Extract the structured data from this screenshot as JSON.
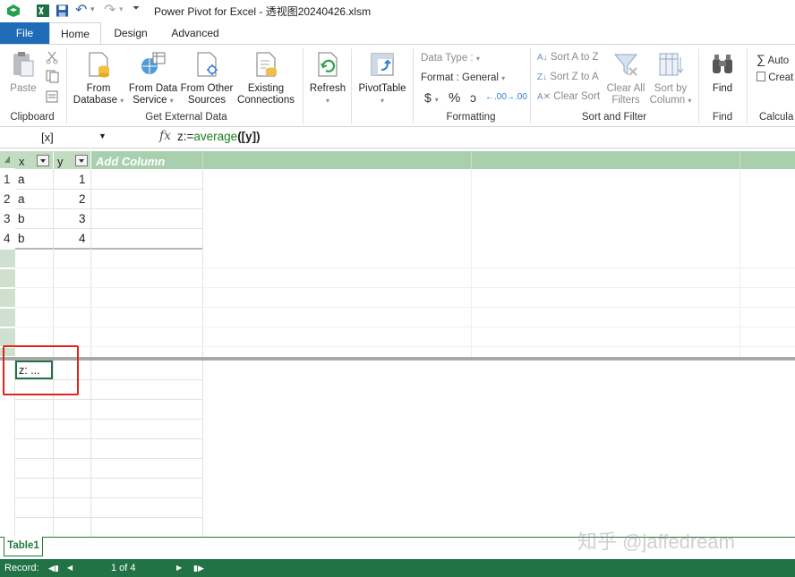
{
  "window": {
    "title": "Power Pivot for Excel - 透视图20240426.xlsm"
  },
  "tabs": [
    {
      "label": "File"
    },
    {
      "label": "Home"
    },
    {
      "label": "Design"
    },
    {
      "label": "Advanced"
    }
  ],
  "ribbon": {
    "clipboard": {
      "paste": "Paste",
      "group": "Clipboard"
    },
    "external": {
      "from_database": [
        "From",
        "Database"
      ],
      "from_data_service": [
        "From Data",
        "Service"
      ],
      "from_other_sources": [
        "From Other",
        "Sources"
      ],
      "existing_connections": [
        "Existing",
        "Connections"
      ],
      "group": "Get External Data"
    },
    "refresh": "Refresh",
    "pivottable": "PivotTable",
    "formatting": {
      "data_type": "Data Type :",
      "format": "Format : General",
      "currency": "$",
      "percent": "%",
      "comma": "ɒ",
      "inc_dec": "←.00",
      "dec_dec": "→.00",
      "group": "Formatting"
    },
    "sort": {
      "sort_az": "Sort A to Z",
      "sort_za": "Sort Z to A",
      "clear_sort": "Clear Sort",
      "clear_filters": [
        "Clear All",
        "Filters"
      ],
      "sort_by_column": [
        "Sort by",
        "Column"
      ],
      "group": "Sort and Filter"
    },
    "find": {
      "label": "Find",
      "group": "Find"
    },
    "calc": {
      "autosum": "Auto",
      "create": "Creat",
      "group": "Calcula"
    }
  },
  "formula_bar": {
    "name_box": "[x]",
    "fx": "fx",
    "formula_prefix": "z:=",
    "formula_fn": "average",
    "formula_args": "([y])"
  },
  "table": {
    "headers": [
      "x",
      "y"
    ],
    "add_column": "Add Column",
    "row_numbers": [
      "1",
      "2",
      "3",
      "4"
    ],
    "rows": [
      {
        "x": "a",
        "y": "1"
      },
      {
        "x": "a",
        "y": "2"
      },
      {
        "x": "b",
        "y": "3"
      },
      {
        "x": "b",
        "y": "4"
      }
    ],
    "measure_cell": "z: ..."
  },
  "sheet_tabs": [
    {
      "label": "Table1"
    }
  ],
  "watermark": "知乎 @jaffedream",
  "status": {
    "record_label": "Record:",
    "position": "1 of 4"
  },
  "colors": {
    "file_tab": "#1f6bb8",
    "status_bar": "#217346",
    "header": "#c1dcc1",
    "highlight": "#e0241b"
  }
}
